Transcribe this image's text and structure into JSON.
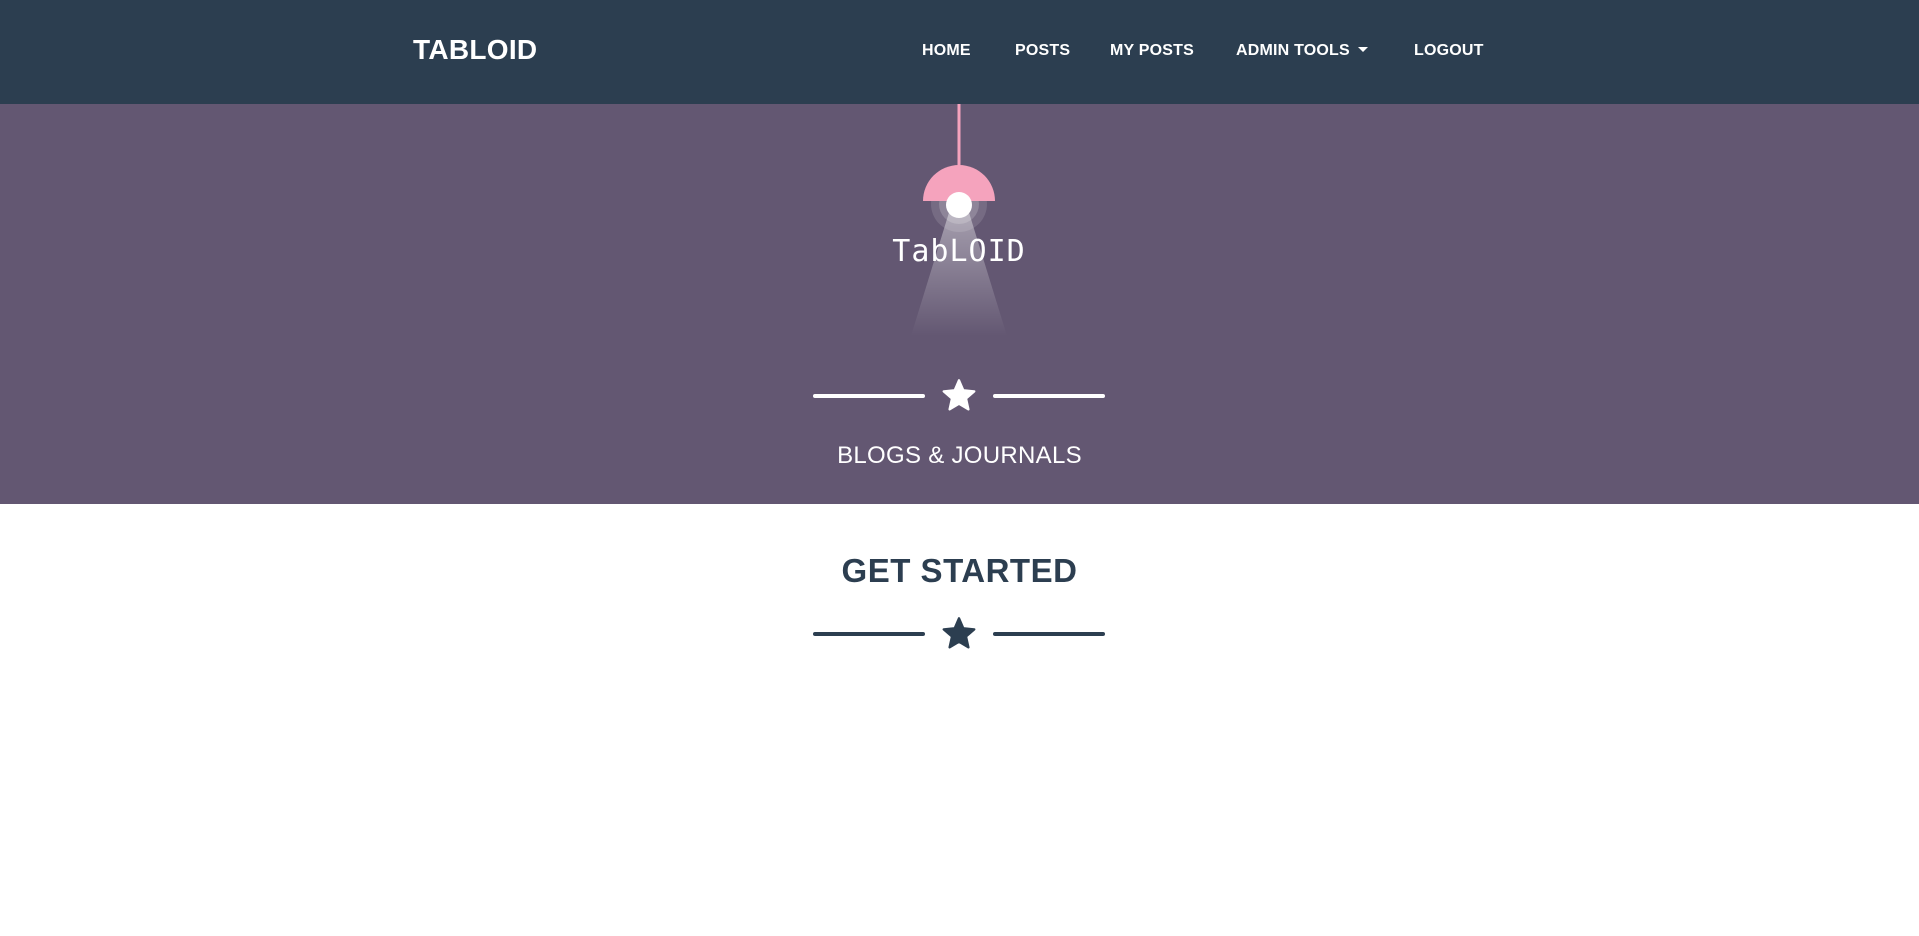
{
  "navbar": {
    "brand": "TABLOID",
    "links": [
      {
        "label": "HOME"
      },
      {
        "label": "POSTS"
      },
      {
        "label": "MY POSTS"
      },
      {
        "label": "ADMIN TOOLS",
        "has_dropdown": true
      },
      {
        "label": "LOGOUT"
      }
    ]
  },
  "masthead": {
    "logo_text": "TabLOID",
    "tagline": "BLOGS & JOURNALS",
    "divider_icon": "star-icon"
  },
  "get_started": {
    "title": "GET STARTED",
    "divider_icon": "star-icon"
  },
  "colors": {
    "navbar_bg": "#2c3e50",
    "masthead_bg": "#635772",
    "lamp_pink": "#f5a3bd",
    "text_light": "#ffffff",
    "text_dark": "#2c3e50"
  }
}
